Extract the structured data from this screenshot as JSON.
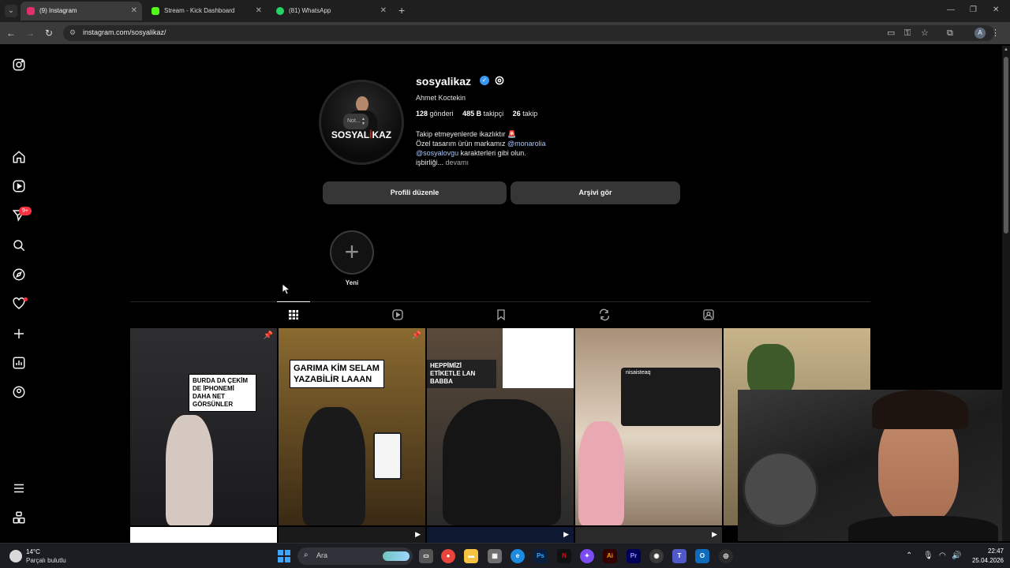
{
  "browser": {
    "tabs": [
      {
        "title": "(9) Instagram",
        "active": true,
        "favicon_color": "#e1306c"
      },
      {
        "title": "Stream - Kick Dashboard",
        "active": false,
        "favicon_color": "#53fc18"
      },
      {
        "title": "(81) WhatsApp",
        "active": false,
        "favicon_color": "#25d366"
      }
    ],
    "url": "instagram.com/sosyalikaz/",
    "profile_initial": "A"
  },
  "sidebar": {
    "notification_badge": "9+",
    "icons": [
      "instagram-logo-icon",
      "home-icon",
      "reels-icon",
      "messages-icon",
      "search-icon",
      "explore-icon",
      "notifications-icon",
      "create-icon",
      "dashboard-icon",
      "profile-icon",
      "more-menu-icon",
      "also-from-meta-icon"
    ]
  },
  "profile": {
    "note_label": "Not...",
    "avatar_logo_left": "SOSYAL",
    "avatar_logo_mid": "İ",
    "avatar_logo_right": "KAZ",
    "username": "sosyalikaz",
    "full_name": "Ahmet Koctekin",
    "posts_count": "128",
    "posts_label": "gönderi",
    "followers_count": "485 B",
    "followers_label": "takipçi",
    "following_count": "26",
    "following_label": "takip",
    "bio_line1": "Takip etmeyenlerde ikazlıktır 🚨",
    "bio_line2_prefix": "Özel tasarım ürün markamız ",
    "bio_mention1": "@monarolia",
    "bio_mention2": "@sosyalovgu",
    "bio_line3_suffix": " karakterleri gibi olun.",
    "bio_line4": "işbirliği...",
    "bio_more": "devamı",
    "edit_profile_button": "Profili düzenle",
    "archive_button": "Arşivi gör",
    "new_highlight_label": "Yeni"
  },
  "posts": [
    {
      "caption": "BURDA DA ÇEKİM DE İPHONEMİ DAHA NET GÖRSÜNLER",
      "pinned": true
    },
    {
      "caption": "GARIMA KİM SELAM YAZABİLİR LAAAN",
      "pinned": true
    },
    {
      "caption": "HEPPİMİZİ ETİKETLE LAN BABBA",
      "pinned": false
    },
    {
      "caption": "nisaisteaq",
      "pinned": false
    },
    {
      "caption": "",
      "pinned": false
    }
  ],
  "taskbar": {
    "weather_temp": "14°C",
    "weather_desc": "Parçalı bulutlu",
    "search_placeholder": "Ara",
    "time": "22:47",
    "date": "25.04.2026"
  }
}
